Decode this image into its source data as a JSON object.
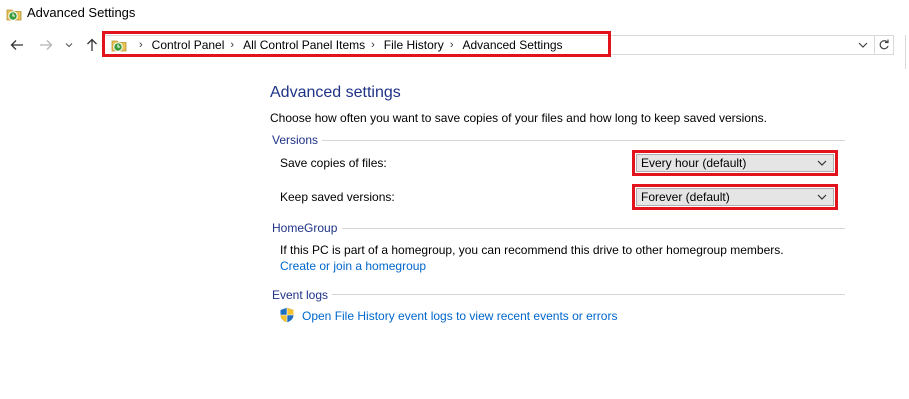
{
  "window": {
    "title": "Advanced Settings"
  },
  "nav": {
    "back_icon": "back-arrow-icon",
    "forward_icon": "forward-arrow-icon",
    "recent_icon": "chevron-down-icon",
    "up_icon": "up-arrow-icon"
  },
  "address": {
    "crumbs": [
      "Control Panel",
      "All Control Panel Items",
      "File History",
      "Advanced Settings"
    ]
  },
  "page": {
    "title": "Advanced settings",
    "description": "Choose how often you want to save copies of your files and how long to keep saved versions."
  },
  "versions": {
    "heading": "Versions",
    "save_copies_label": "Save copies of files:",
    "save_copies_value": "Every hour (default)",
    "keep_versions_label": "Keep saved versions:",
    "keep_versions_value": "Forever (default)"
  },
  "homegroup": {
    "heading": "HomeGroup",
    "text": "If this PC is part of a homegroup, you can recommend this drive to other homegroup members.",
    "link": "Create or join a homegroup"
  },
  "eventlogs": {
    "heading": "Event logs",
    "link": "Open File History event logs to view recent events or errors"
  },
  "colors": {
    "heading_blue": "#1e3287",
    "link_blue": "#0066cc",
    "highlight_red": "#e3131e"
  }
}
